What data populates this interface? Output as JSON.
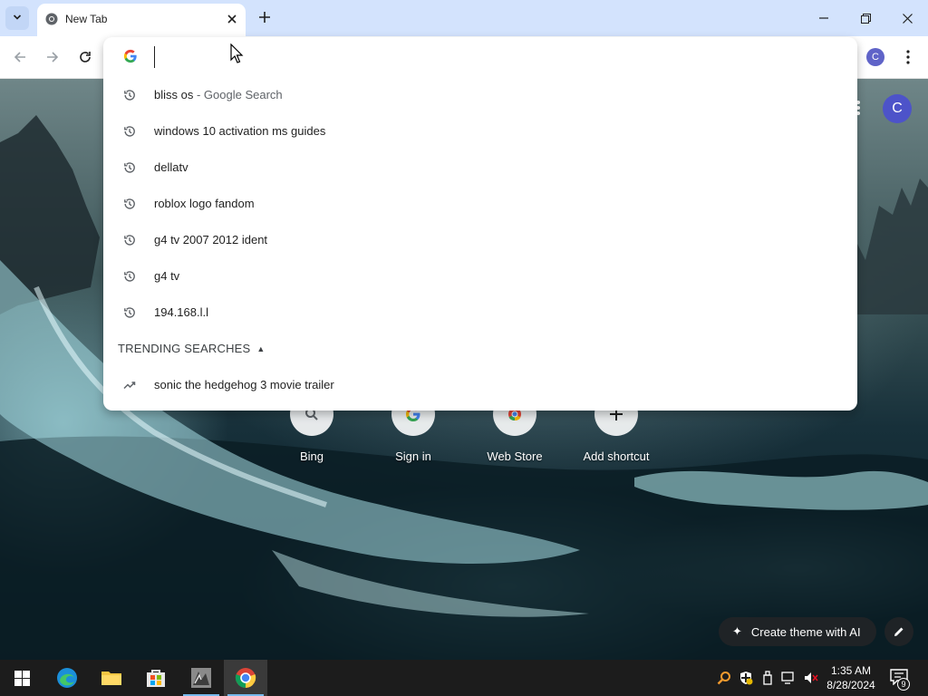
{
  "browser": {
    "tab": {
      "title": "New Tab"
    },
    "toolbar": {
      "profile_initial": "C"
    }
  },
  "omnibox": {
    "input_value": "",
    "suggestions": [
      {
        "text": "bliss os",
        "suffix": " - Google Search",
        "icon": "history-icon"
      },
      {
        "text": "windows 10 activation ms guides",
        "suffix": "",
        "icon": "history-icon"
      },
      {
        "text": "dellatv",
        "suffix": "",
        "icon": "history-icon"
      },
      {
        "text": "roblox logo fandom",
        "suffix": "",
        "icon": "history-icon"
      },
      {
        "text": "g4 tv 2007 2012 ident",
        "suffix": "",
        "icon": "history-icon"
      },
      {
        "text": "g4 tv",
        "suffix": "",
        "icon": "history-icon"
      },
      {
        "text": "194.168.l.l",
        "suffix": "",
        "icon": "history-icon"
      }
    ],
    "trending_header": "TRENDING SEARCHES",
    "trending": [
      {
        "text": "sonic the hedgehog 3 movie trailer",
        "icon": "trending-icon"
      }
    ]
  },
  "ntp": {
    "avatar_initial": "C",
    "shortcuts": [
      {
        "label": "Bing",
        "icon": "search-icon"
      },
      {
        "label": "Sign in",
        "icon": "google-icon"
      },
      {
        "label": "Web Store",
        "icon": "webstore-icon"
      },
      {
        "label": "Add shortcut",
        "icon": "plus-icon"
      }
    ],
    "create_theme_label": "Create theme with AI"
  },
  "taskbar": {
    "time": "1:35 AM",
    "date": "8/28/2024",
    "notification_count": "9"
  },
  "colors": {
    "tabstrip": "#d3e3fd",
    "accent_profile": "#5f63c8",
    "taskbar": "#1c1c1c"
  }
}
